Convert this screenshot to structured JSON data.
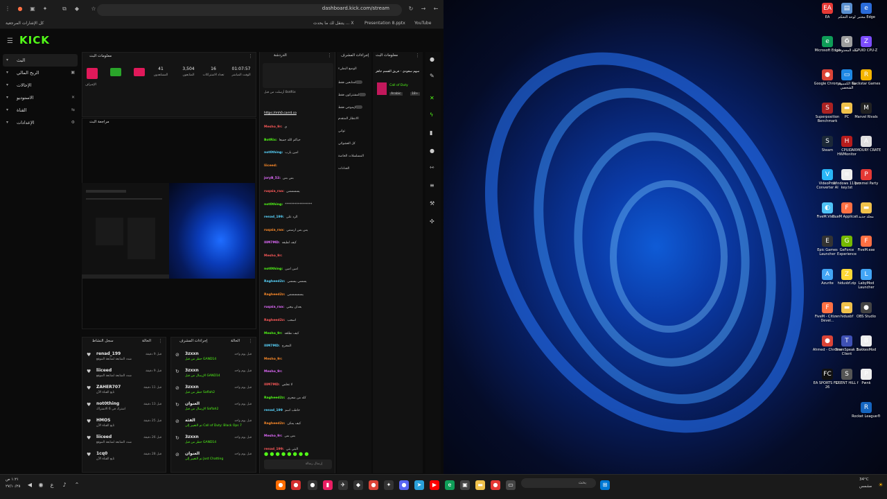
{
  "browser": {
    "url": "dashboard.kick.com/stream",
    "bookmarks": {
      "all": "كل الإشارات المرجعية",
      "x": "يتنقل لك ما يحدث ... X",
      "ppt": "Presentation 8.pptx",
      "yt": "YouTube"
    }
  },
  "kick": {
    "logo": "KICK",
    "nav": [
      {
        "label": "البث"
      },
      {
        "label": "الربح المالي"
      },
      {
        "label": "الإحالات"
      },
      {
        "label": "الاستوديو"
      },
      {
        "label": "القناة"
      },
      {
        "label": "الإعدادات"
      }
    ]
  },
  "stream_info": {
    "title": "معلومات البث",
    "status": "الإشراف",
    "stats": [
      {
        "value": "01:07:57",
        "label": "الوقت المباشر"
      },
      {
        "value": "16",
        "label": "تعداد الاشتراكات"
      },
      {
        "value": "3,504",
        "label": "المتابعون"
      },
      {
        "value": "41",
        "label": "المشاهدون"
      }
    ],
    "preview_title": "مراجعة البث"
  },
  "activity": {
    "title": "سجل النشاط",
    "filter": "الحالة",
    "rows": [
      {
        "name": "renad_199",
        "sub": "شدد المتابعة لمتابعة الموقع",
        "time": "قبل 9 دقيقة"
      },
      {
        "name": "liiceed",
        "sub": "شدد المتابعة لمتابعة الموقع",
        "time": "قبل 9 دقيقة"
      },
      {
        "name": "ZAHER707",
        "sub": "تابع القناة الآن",
        "time": "قبل 11 دقيقة"
      },
      {
        "name": "not0thing",
        "sub": "اشترك في 6 الاشتراك",
        "time": "قبل 13 دقيقة"
      },
      {
        "name": "HMOS",
        "sub": "تابع القناة الآن",
        "time": "قبل 25 دقيقة"
      },
      {
        "name": "liiceed",
        "sub": "شدد المتابعة لمتابعة الموقع",
        "time": "قبل 26 دقيقة"
      },
      {
        "name": "1cq0",
        "sub": "تابع القناة الآن",
        "time": "قبل 28 دقيقة"
      }
    ]
  },
  "modlog": {
    "title": "إجراءات المشرف",
    "filter": "الحالة",
    "rows": [
      {
        "name": "3zxxn",
        "sub": "حظر من قبل GAND14",
        "time": "قبل يوم واحد"
      },
      {
        "name": "3zxxn",
        "sub": "الإرسال من قبل GAND14",
        "time": "قبل يوم واحد"
      },
      {
        "name": "3zxxn",
        "sub": "حظر من قبل Saflah2",
        "time": "قبل يوم واحد"
      },
      {
        "name": "العنوان",
        "sub": "الإرسال من قبل Saflah2",
        "time": "قبل يوم واحد"
      },
      {
        "name": "الفئة",
        "sub": "تم التغيير إلى Call of Duty: Black Ops 7",
        "time": "قبل يوم واحد"
      },
      {
        "name": "3zxxn",
        "sub": "حظر من قبل GAND14",
        "time": "قبل يوم واحد"
      },
      {
        "name": "العنوان",
        "sub": "تم التغيير إلى Just Chatting",
        "time": "قبل يوم واحد"
      }
    ]
  },
  "chat": {
    "title": "الدردشة",
    "pinned": "أرسلت من قبل BotRix",
    "link": "https://mh0.carrd.co",
    "messages": [
      {
        "user": "Mesho_9r:",
        "text": "ي"
      },
      {
        "user": "BotRix:",
        "text": "حياكم الله جميعا"
      },
      {
        "user": "not0thing:",
        "text": "امين يارب"
      },
      {
        "user": "liiceed:",
        "text": ""
      },
      {
        "user": "joryB_52:",
        "text": "بس بس"
      },
      {
        "user": "ruqaia_raa:",
        "text": "يسسسس"
      },
      {
        "user": "not0thing:",
        "text": "*****************"
      },
      {
        "user": "renad_199:",
        "text": "الرد على"
      },
      {
        "user": "ruqaia_raa:",
        "text": "يس بس ارسمي"
      },
      {
        "user": "lllM7MD:",
        "text": "كيف لطيفه"
      },
      {
        "user": "Mesho_9r:",
        "text": ""
      },
      {
        "user": "not0thing:",
        "text": "امين امين"
      },
      {
        "user": "Ragheed2z:",
        "text": "يسسي يسسي"
      },
      {
        "user": "Ragheed2z:",
        "text": "يسسسسس"
      },
      {
        "user": "ruqaia_raa:",
        "text": "بعدان بيغني"
      },
      {
        "user": "Ragheed2z:",
        "text": "اسحب"
      },
      {
        "user": "Mesho_9r:",
        "text": "كيف نطلعه"
      },
      {
        "user": "lllM7MD:",
        "text": "المخرج"
      },
      {
        "user": "Mesho_9r:",
        "text": ""
      },
      {
        "user": "Mesho_9r:",
        "text": ""
      },
      {
        "user": "lllM7MD:",
        "text": "لا تخلص"
      },
      {
        "user": "Ragheed2z:",
        "text": "كله من شعري"
      },
      {
        "user": "renad_199",
        "text": "خاطب اسم"
      },
      {
        "user": "Ragheed2z:",
        "text": "كيف يمكن"
      },
      {
        "user": "Mesho_9r:",
        "text": "بس بس"
      },
      {
        "user": "renad_199:",
        "text": "البثي بثي"
      },
      {
        "user": "liiceed:",
        "text": "رواه"
      }
    ],
    "input_placeholder": "إرسال رسالة"
  },
  "mod_actions": {
    "title": "إجراءات المشرف",
    "items": [
      "الوضع البطيء",
      "للمتابعين فقط",
      "المشتركون فقط",
      "الإيموجي فقط",
      "الانتظار المتقدم",
      "ثواني",
      "كل العشوائي",
      "المسلسلات الخاصة",
      "العدادات"
    ]
  },
  "stream_panel": {
    "title": "معلومات البث",
    "stream_title": "سهم سعودي - فريق القسم جاهز",
    "language": "Arabic",
    "tag": "Call of Duty",
    "badge": "18+"
  },
  "desktop": {
    "icons": [
      {
        "label": "مختبر Edge",
        "color": "#2a6bd8",
        "glyph": "e"
      },
      {
        "label": "لوحة التحكم",
        "color": "#5a8fcf",
        "glyph": "▤"
      },
      {
        "label": "EA",
        "color": "#e53935",
        "glyph": "EA"
      },
      {
        "label": "CPUID CPU-Z",
        "color": "#7c4dff",
        "glyph": "Z"
      },
      {
        "label": "سلة المحذوفات",
        "color": "#9e9e9e",
        "glyph": "♻"
      },
      {
        "label": "Microsoft Edge",
        "color": "#0f9d58",
        "glyph": "e"
      },
      {
        "label": "Rockstar Games",
        "color": "#f4b400",
        "glyph": "R"
      },
      {
        "label": "هذا الكمبيوتر الشخصي",
        "color": "#1e88e5",
        "glyph": "▭"
      },
      {
        "label": "Google Chrome",
        "color": "#db4437",
        "glyph": "●"
      },
      {
        "label": "Marvel Rivals",
        "color": "#222",
        "glyph": "M"
      },
      {
        "label": "PC",
        "color": "#f0c14b",
        "glyph": "▬"
      },
      {
        "label": "Superposition Benchmark",
        "color": "#aa2222",
        "glyph": "S"
      },
      {
        "label": "ARMOURY CRATE",
        "color": "#e0e0e0",
        "glyph": "A"
      },
      {
        "label": "CPUID HWMonitor",
        "color": "#b71c1c",
        "glyph": "H"
      },
      {
        "label": "Steam",
        "color": "#1b2838",
        "glyph": "S"
      },
      {
        "label": "Pummel Party",
        "color": "#e53935",
        "glyph": "P"
      },
      {
        "label": "Windows 11 pro key.txt",
        "color": "#eeeeee",
        "glyph": "≡"
      },
      {
        "label": "VideoProc Converter AI",
        "color": "#29b6f6",
        "glyph": "V"
      },
      {
        "label": "مجلد جديد",
        "color": "#f0c14b",
        "glyph": "▬"
      },
      {
        "label": "FiveM Applicati...",
        "color": "#ff7043",
        "glyph": "F"
      },
      {
        "label": "FiveM.Visu...",
        "color": "#4fc3f7",
        "glyph": "◐"
      },
      {
        "label": "FiveM.exe",
        "color": "#ff7043",
        "glyph": "F"
      },
      {
        "label": "GeForce Experience",
        "color": "#76b900",
        "glyph": "G"
      },
      {
        "label": "Epic Games Launcher",
        "color": "#333",
        "glyph": "E"
      },
      {
        "label": "LabyMod Launcher",
        "color": "#42a5f5",
        "glyph": "L"
      },
      {
        "label": "hidusbf.zip",
        "color": "#fdd835",
        "glyph": "Z"
      },
      {
        "label": "Azurite",
        "color": "#42a5f5",
        "glyph": "A"
      },
      {
        "label": "OBS Studio",
        "color": "#444",
        "glyph": "●"
      },
      {
        "label": "hidusbf",
        "color": "#f0c14b",
        "glyph": "▬"
      },
      {
        "label": "FiveM - Citizen Devel...",
        "color": "#ff7043",
        "glyph": "F"
      },
      {
        "label": "BakkesMod",
        "color": "#eeeeee",
        "glyph": "B"
      },
      {
        "label": "TeamSpeak 3 Client",
        "color": "#3f51b5",
        "glyph": "T"
      },
      {
        "label": "Ahmed - Chrome",
        "color": "#db4437",
        "glyph": "●"
      },
      {
        "label": "Pwnk",
        "color": "#eeeeee",
        "glyph": "P"
      },
      {
        "label": "SILENT HILL f",
        "color": "#555",
        "glyph": "S"
      },
      {
        "label": "EA SPORTS FC™ 26",
        "color": "#111",
        "glyph": "FC"
      },
      {
        "label": "Rocket League®",
        "color": "#1565c0",
        "glyph": "R"
      }
    ]
  },
  "taskbar": {
    "search": "بحث",
    "weather_temp": "34°C",
    "weather_desc": "مشمس",
    "time": "١:٢١ ص",
    "date": "٢٧/١٠/٢٥"
  }
}
